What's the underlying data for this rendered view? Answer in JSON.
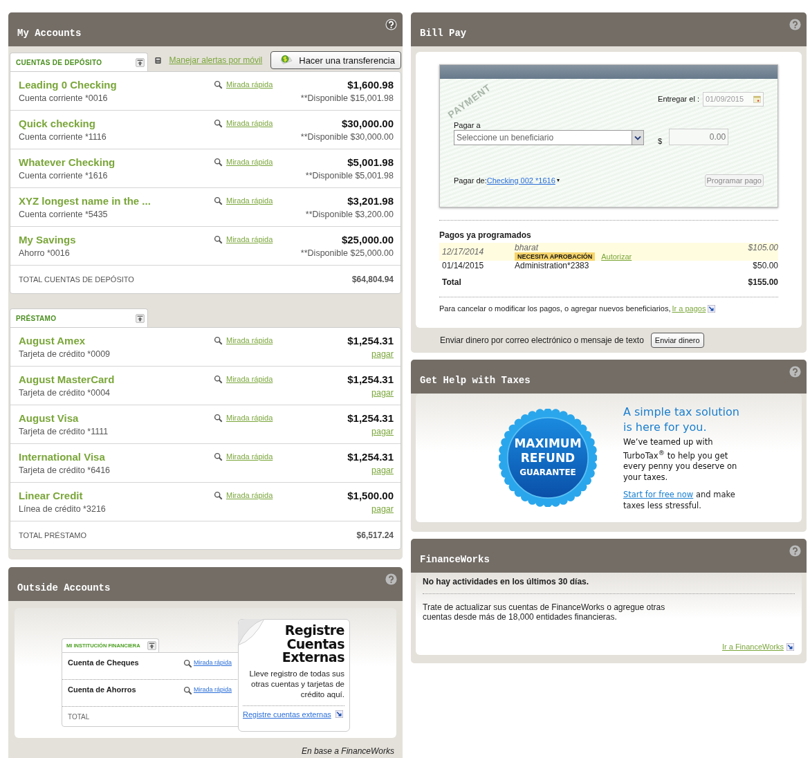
{
  "my_accounts": {
    "title": "My Accounts",
    "mobile_alerts_link": "Manejar alertas por móvil",
    "transfer_button": "Hacer una transferencia",
    "sections": [
      {
        "title": "CUENTAS DE DEPÓSITO",
        "total_label": "TOTAL CUENTAS DE DEPÓSITO",
        "total": "$64,804.94",
        "rows": [
          {
            "kind": "deposit",
            "name": "Leading 0 Checking",
            "subtitle": "Cuenta corriente *0016",
            "quick_look": "Mirada rápida",
            "amount": "$1,600.98",
            "detail": "**Disponible $15,001.98"
          },
          {
            "kind": "deposit",
            "name": "Quick checking",
            "subtitle": "Cuenta corriente *1116",
            "quick_look": "Mirada rápida",
            "amount": "$30,000.00",
            "detail": "**Disponible $30,000.00"
          },
          {
            "kind": "deposit",
            "name": "Whatever Checking",
            "subtitle": "Cuenta corriente *1616",
            "quick_look": "Mirada rápida",
            "amount": "$5,001.98",
            "detail": "**Disponible $5,001.98"
          },
          {
            "kind": "deposit",
            "name": "XYZ longest name in the ...",
            "subtitle": "Cuenta corriente *5435",
            "quick_look": "Mirada rápida",
            "amount": "$3,201.98",
            "detail": "**Disponible $3,200.00"
          },
          {
            "kind": "deposit",
            "name": "My Savings",
            "subtitle": "Ahorro *0016",
            "quick_look": "Mirada rápida",
            "amount": "$25,000.00",
            "detail": "**Disponible $25,000.00"
          }
        ]
      },
      {
        "title": "PRÉSTAMO",
        "total_label": "TOTAL PRÉSTAMO",
        "total": "$6,517.24",
        "rows": [
          {
            "kind": "credit",
            "name": "August Amex",
            "subtitle": "Tarjeta de crédito *0009",
            "quick_look": "Mirada rápida",
            "amount": "$1,254.31",
            "detail": "pagar"
          },
          {
            "kind": "credit",
            "name": "August MasterCard",
            "subtitle": "Tarjeta de crédito *0004",
            "quick_look": "Mirada rápida",
            "amount": "$1,254.31",
            "detail": "pagar"
          },
          {
            "kind": "credit",
            "name": "August Visa",
            "subtitle": "Tarjeta de crédito *1111",
            "quick_look": "Mirada rápida",
            "amount": "$1,254.31",
            "detail": "pagar"
          },
          {
            "kind": "credit",
            "name": "International Visa",
            "subtitle": "Tarjeta de crédito *6416",
            "quick_look": "Mirada rápida",
            "amount": "$1,254.31",
            "detail": "pagar"
          },
          {
            "kind": "credit",
            "name": "Linear Credit",
            "subtitle": "Línea de crédito *3216",
            "quick_look": "Mirada rápida",
            "amount": "$1,500.00",
            "detail": "pagar"
          }
        ]
      }
    ]
  },
  "outside_accounts": {
    "title": "Outside Accounts",
    "sample_card": {
      "title": "MI INSTITUCIÓN FINANCIERA",
      "rows": [
        {
          "name": "Cuenta de Cheques",
          "quick_look": "Mirada rápida"
        },
        {
          "name": "Cuenta de Ahorros",
          "quick_look": "Mirada rápida"
        }
      ],
      "total_label": "TOTAL"
    },
    "promo": {
      "title_lines": [
        "Registre",
        "Cuentas",
        "Externas"
      ],
      "body": "Lleve registro de todas sus otras cuentas y tarjetas de crédito aquí.",
      "link": "Registre cuentas externas"
    },
    "footer": "En base a FinanceWorks"
  },
  "bill_pay": {
    "title": "Bill Pay",
    "stamp": "PAYMENT",
    "deliver_label": "Entregar el :",
    "deliver_date": "01/09/2015",
    "pay_to_label": "Pagar a",
    "payee_placeholder": "Seleccione un beneficiario",
    "currency": "$",
    "amount_placeholder": "0.00",
    "pay_from_label": "Pagar de:",
    "pay_from_account": "Checking 002 *1616",
    "schedule_button": "Programar pago",
    "scheduled_title": "Pagos ya programados",
    "payments": [
      {
        "date": "12/17/2014",
        "payee": "bharat",
        "amount": "$105.00",
        "pending": true,
        "badge": "NECESITA APROBACIÓN",
        "action": "Autorizar"
      },
      {
        "date": "01/14/2015",
        "payee": "Administration*2383",
        "amount": "$50.00",
        "pending": false
      }
    ],
    "total_label": "Total",
    "total": "$155.00",
    "note": "Para cancelar o modificar los pagos, o agregar nuevos beneficiarios,",
    "note_link": "Ir a pagos",
    "send_label": "Enviar dinero por correo electrónico o mensaje de texto",
    "send_button": "Enviar dinero"
  },
  "taxes": {
    "title": "Get Help with Taxes",
    "seal_lines": [
      "MAXIMUM",
      "REFUND",
      "GUARANTEE"
    ],
    "headline": "A simple tax solution is here for you.",
    "body": "We’ve teamed up with TurboTax$^{®}$ to help you get every penny you deserve on your taxes.",
    "link": "Start for free now",
    "tail": "and make taxes less stressful."
  },
  "financeworks": {
    "title": "FinanceWorks",
    "message": "No hay actividades en los últimos 30 días.",
    "body": "Trate de actualizar sus cuentas de FinanceWorks o agregue otras cuentas desde más de 18,000 entidades financieras.",
    "link": "Ir a FinanceWorks"
  }
}
